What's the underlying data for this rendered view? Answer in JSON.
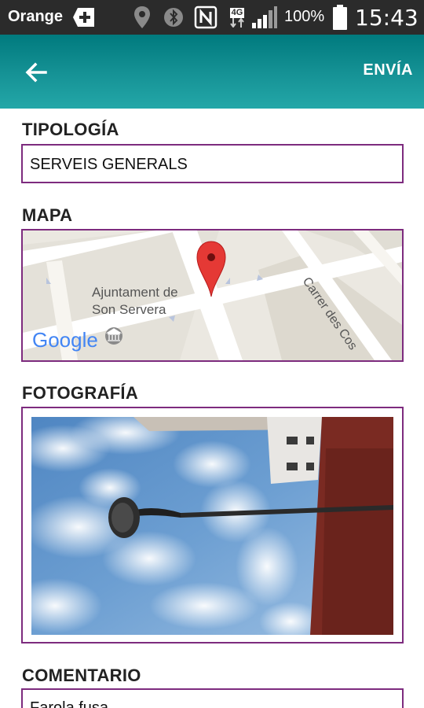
{
  "status_bar": {
    "carrier": "Orange",
    "battery": "100%",
    "time": "15:43",
    "network_badge": "4G",
    "icons": [
      "add-icon",
      "location-icon",
      "bluetooth-icon",
      "nfc-icon",
      "signal-icon",
      "battery-icon"
    ]
  },
  "app_bar": {
    "back_icon": "arrow-left-icon",
    "send_label": "ENVÍA",
    "color": "#169396"
  },
  "form": {
    "typology": {
      "label": "TIPOLOGÍA",
      "value": "SERVEIS GENERALS"
    },
    "map": {
      "label": "MAPA",
      "place_label_line1": "Ajuntament de",
      "place_label_line2": "Son Servera",
      "street_label": "Carrer des Cos",
      "logo": "Google"
    },
    "photo": {
      "label": "FOTOGRAFÍA"
    },
    "comment": {
      "label": "COMENTARIO",
      "value": "Farola fusa"
    }
  },
  "colors": {
    "field_border": "#7d2b7e",
    "marker": "#e53935"
  }
}
